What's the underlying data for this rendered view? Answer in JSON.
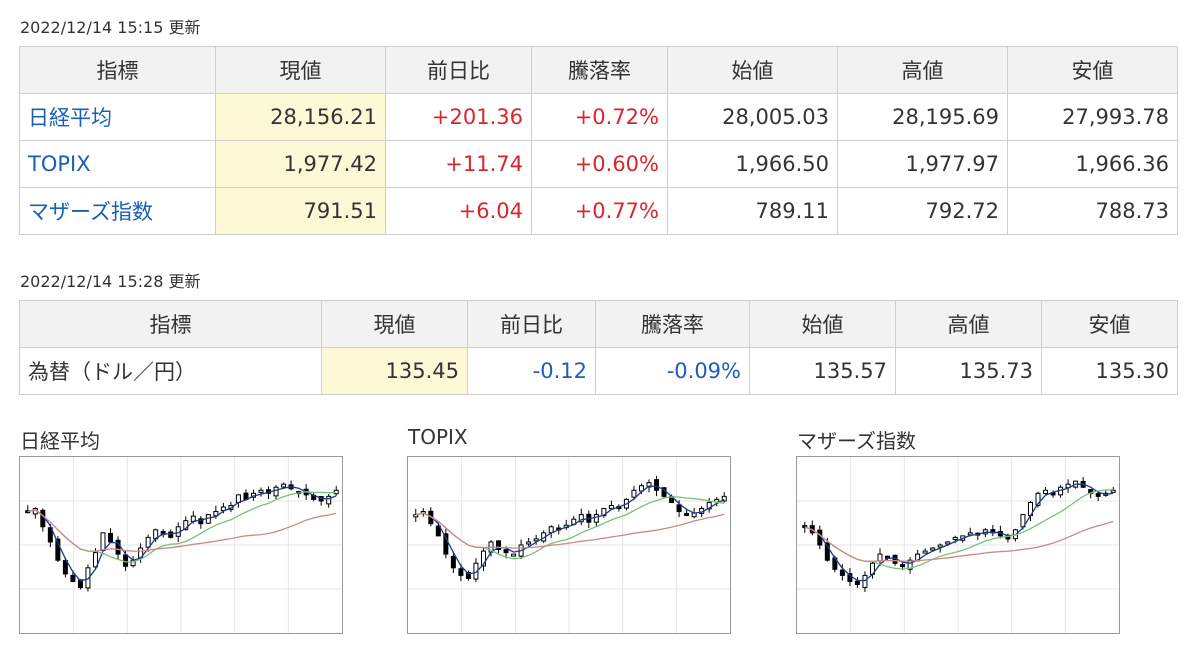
{
  "stocks": {
    "updated": "2022/12/14 15:15 更新",
    "headers": [
      "指標",
      "現値",
      "前日比",
      "騰落率",
      "始値",
      "高値",
      "安値"
    ],
    "rows": [
      {
        "name": "日経平均",
        "current": "28,156.21",
        "change": "+201.36",
        "rate": "+0.72%",
        "open": "28,005.03",
        "high": "28,195.69",
        "low": "27,993.78",
        "dir": "up"
      },
      {
        "name": "TOPIX",
        "current": "1,977.42",
        "change": "+11.74",
        "rate": "+0.60%",
        "open": "1,966.50",
        "high": "1,977.97",
        "low": "1,966.36",
        "dir": "up"
      },
      {
        "name": "マザーズ指数",
        "current": "791.51",
        "change": "+6.04",
        "rate": "+0.77%",
        "open": "789.11",
        "high": "792.72",
        "low": "788.73",
        "dir": "up"
      }
    ]
  },
  "fx": {
    "updated": "2022/12/14 15:28 更新",
    "headers": [
      "指標",
      "現値",
      "前日比",
      "騰落率",
      "始値",
      "高値",
      "安値"
    ],
    "rows": [
      {
        "name": "為替（ドル／円）",
        "current": "135.45",
        "change": "-0.12",
        "rate": "-0.09%",
        "open": "135.57",
        "high": "135.73",
        "low": "135.30",
        "dir": "down"
      }
    ]
  },
  "colors": {
    "up": "#d9252b",
    "down": "#1d5cc0",
    "link": "#1a5fb4",
    "highlight": "#fdf9d6"
  },
  "charts": [
    {
      "id": "nikkei",
      "title": "日経平均",
      "seed": 11,
      "candles": [
        0.72,
        0.74,
        0.62,
        0.52,
        0.4,
        0.31,
        0.26,
        0.22,
        0.35,
        0.45,
        0.58,
        0.52,
        0.44,
        0.36,
        0.4,
        0.48,
        0.55,
        0.6,
        0.57,
        0.55,
        0.62,
        0.66,
        0.69,
        0.64,
        0.7,
        0.72,
        0.75,
        0.76,
        0.83,
        0.8,
        0.84,
        0.86,
        0.84,
        0.88,
        0.9,
        0.87,
        0.85,
        0.83,
        0.8,
        0.79,
        0.82,
        0.86
      ]
    },
    {
      "id": "topix",
      "title": "TOPIX",
      "seed": 23,
      "candles": [
        0.7,
        0.72,
        0.64,
        0.56,
        0.44,
        0.35,
        0.3,
        0.28,
        0.38,
        0.46,
        0.52,
        0.47,
        0.45,
        0.44,
        0.5,
        0.52,
        0.54,
        0.58,
        0.62,
        0.6,
        0.63,
        0.67,
        0.7,
        0.65,
        0.7,
        0.74,
        0.76,
        0.75,
        0.8,
        0.86,
        0.89,
        0.91,
        0.86,
        0.82,
        0.78,
        0.72,
        0.7,
        0.71,
        0.74,
        0.78,
        0.8,
        0.82
      ]
    },
    {
      "id": "mothers",
      "title": "マザーズ指数",
      "seed": 37,
      "candles": [
        0.62,
        0.58,
        0.5,
        0.4,
        0.34,
        0.3,
        0.26,
        0.24,
        0.3,
        0.38,
        0.44,
        0.42,
        0.38,
        0.36,
        0.4,
        0.44,
        0.46,
        0.48,
        0.5,
        0.52,
        0.55,
        0.56,
        0.58,
        0.57,
        0.6,
        0.58,
        0.56,
        0.54,
        0.6,
        0.7,
        0.78,
        0.84,
        0.86,
        0.84,
        0.88,
        0.9,
        0.92,
        0.88,
        0.84,
        0.82,
        0.84,
        0.86
      ]
    }
  ]
}
